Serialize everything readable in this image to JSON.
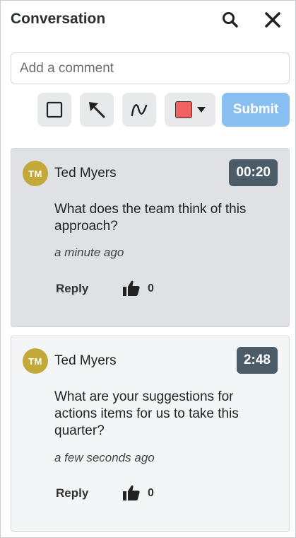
{
  "header": {
    "title": "Conversation"
  },
  "composer": {
    "placeholder": "Add a comment",
    "value": "",
    "submit_label": "Submit",
    "tools": [
      "rectangle-icon",
      "arrow-icon",
      "freehand-curve-icon",
      "color-picker"
    ],
    "selected_color": "#f26262"
  },
  "comments": [
    {
      "initials": "TM",
      "author": "Ted Myers",
      "timestamp": "00:20",
      "text": "What does the team think of this approach?",
      "ago": "a minute ago",
      "reply_label": "Reply",
      "likes": "0"
    },
    {
      "initials": "TM",
      "author": "Ted Myers",
      "timestamp": "2:48",
      "text": "What are your suggestions for actions items for us to take this quarter?",
      "ago": "a few seconds ago",
      "reply_label": "Reply",
      "likes": "0"
    }
  ],
  "colors": {
    "submit_bg": "#89bff0",
    "badge_bg": "#4b5b68",
    "avatar_bg": "#c3a83a",
    "active_card_bg": "#dfe1e4"
  }
}
